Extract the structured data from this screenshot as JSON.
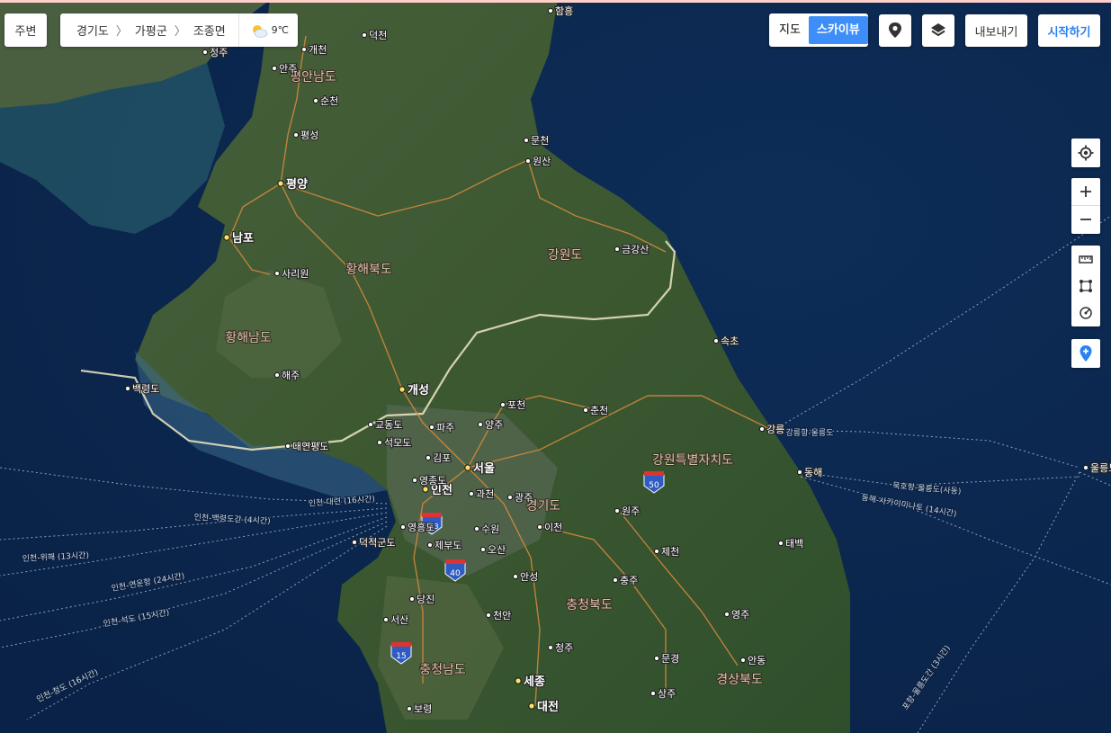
{
  "top_bar": {
    "nearby_label": "주변",
    "breadcrumb": [
      "경기도",
      "가평군",
      "조종면"
    ],
    "weather_temp": "9℃",
    "weather_icon": "partly-cloudy-icon",
    "map_type": {
      "options": [
        "지도",
        "스카이뷰"
      ],
      "selected": "스카이뷰"
    },
    "export_label": "내보내기",
    "start_label": "시작하기",
    "accent_color": "#3d8ef8"
  },
  "side_controls": {
    "icons": [
      "current-location-icon",
      "zoom-in-icon",
      "zoom-out-icon",
      "ruler-icon",
      "area-icon",
      "radius-icon",
      "add-pin-icon"
    ]
  },
  "map": {
    "cities_major": [
      "평양",
      "남포",
      "개성",
      "서울",
      "인천",
      "세종",
      "대전"
    ],
    "cities_minor": [
      "함흥",
      "정주",
      "개천",
      "덕천",
      "안주",
      "순천",
      "평성",
      "문천",
      "원산",
      "사리원",
      "해주",
      "금강산",
      "속초",
      "포천",
      "춘천",
      "파주",
      "양주",
      "강릉",
      "교동도",
      "석모도",
      "대연평도",
      "백령도",
      "김포",
      "동해",
      "울릉도",
      "영종도",
      "과천",
      "광주",
      "원주",
      "영흥도",
      "수원",
      "이천",
      "덕적군도",
      "제부도",
      "오산",
      "제천",
      "태백",
      "안성",
      "충주",
      "당진",
      "서산",
      "천안",
      "영주",
      "청주",
      "문경",
      "안동",
      "상주",
      "보령"
    ],
    "regions": [
      "평안남도",
      "황해북도",
      "강원도",
      "황해남도",
      "강원특별자치도",
      "경기도",
      "충청북도",
      "충청남도",
      "경상북도"
    ],
    "highway_shields": [
      "50",
      "153",
      "40",
      "15"
    ],
    "ferry_routes": [
      "강릉항-울릉도",
      "묵호항-울릉도(사동)",
      "동해-사카이미나토 (14시간)",
      "인천-대련 (16시간)",
      "인천-백령도간 (4시간)",
      "인천-위해 (13시간)",
      "인천-연운항 (24시간)",
      "인천-석도 (15시간)",
      "인천-청도 (16시간)",
      "포항-울릉도간 (3시간)"
    ]
  }
}
